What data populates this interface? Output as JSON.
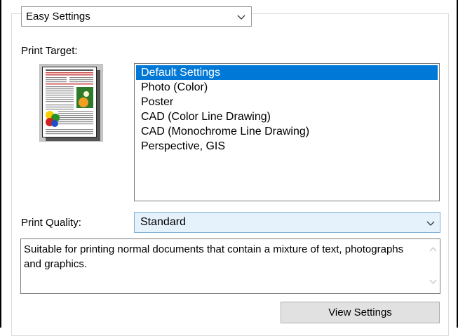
{
  "mode_dropdown": {
    "value": "Easy Settings"
  },
  "print_target": {
    "label": "Print Target:",
    "items": [
      "Default Settings",
      "Photo (Color)",
      "Poster",
      "CAD (Color Line Drawing)",
      "CAD (Monochrome Line Drawing)",
      "Perspective, GIS"
    ],
    "selected_index": 0
  },
  "print_quality": {
    "label": "Print Quality:",
    "value": "Standard"
  },
  "description": {
    "text": "Suitable for printing normal documents that contain a mixture of text, photographs and graphics."
  },
  "buttons": {
    "view_settings": "View Settings"
  },
  "icons": {
    "dropdown": "chevron-down-icon",
    "scroll_up": "scroll-up-arrow-icon",
    "scroll_down": "scroll-down-arrow-icon",
    "preview": "document-preview-icon"
  },
  "colors": {
    "selection": "#0078d7",
    "quality_select_bg": "#e5f1fb",
    "button_bg": "#e1e1e1"
  }
}
